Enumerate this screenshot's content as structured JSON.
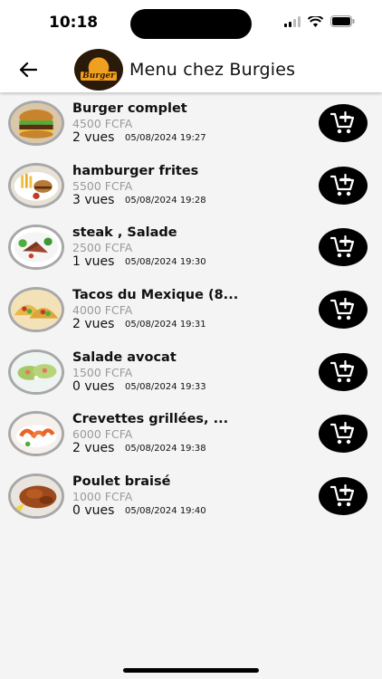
{
  "status_bar": {
    "time": "10:18"
  },
  "header": {
    "title": "Menu chez Burgies",
    "logo_text": "Burger"
  },
  "colors": {
    "price": "#9a9a9a",
    "cart_button_bg": "#000000",
    "header_bg": "#ffffff",
    "page_bg": "#f4f4f4"
  },
  "icons": {
    "back": "arrow-left-icon",
    "cart": "cart-plus-icon"
  },
  "items": [
    {
      "name": "Burger complet",
      "price": "4500 FCFA",
      "views": "2 vues",
      "date": "05/08/2024 19:27",
      "image": "burger"
    },
    {
      "name": "hamburger frites",
      "price": "5500 FCFA",
      "views": "3 vues",
      "date": "05/08/2024 19:28",
      "image": "burger-fries"
    },
    {
      "name": "steak , Salade",
      "price": "2500 FCFA",
      "views": "1 vues",
      "date": "05/08/2024 19:30",
      "image": "steak-salad"
    },
    {
      "name": "Tacos du Mexique (8...",
      "price": "4000 FCFA",
      "views": "2 vues",
      "date": "05/08/2024 19:31",
      "image": "tacos"
    },
    {
      "name": "Salade avocat",
      "price": "1500 FCFA",
      "views": "0 vues",
      "date": "05/08/2024 19:33",
      "image": "avocado-salad"
    },
    {
      "name": "Crevettes grillées, ...",
      "price": "6000 FCFA",
      "views": "2 vues",
      "date": "05/08/2024 19:38",
      "image": "shrimp"
    },
    {
      "name": "Poulet braisé",
      "price": "1000 FCFA",
      "views": "0 vues",
      "date": "05/08/2024 19:40",
      "image": "chicken"
    }
  ]
}
